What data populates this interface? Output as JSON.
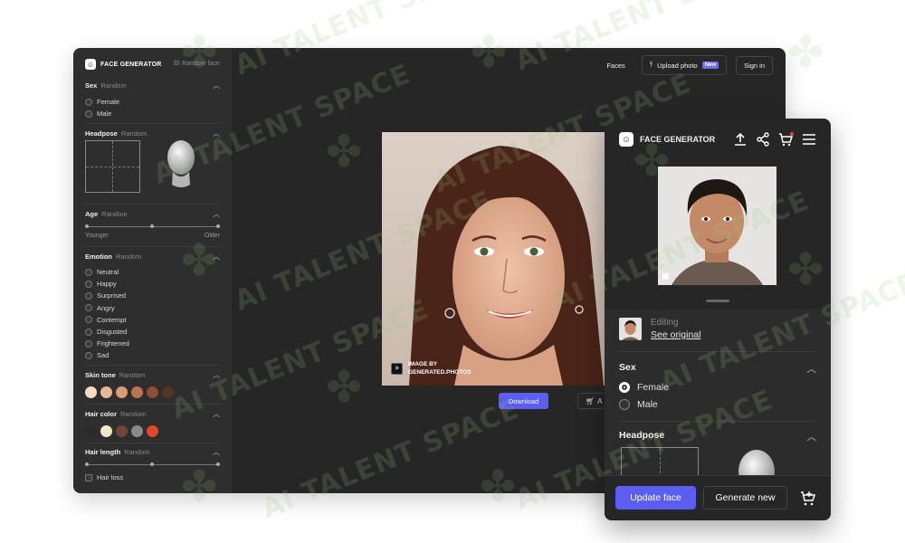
{
  "watermark": {
    "text": "AI TALENT SPACE"
  },
  "desktop": {
    "brand": "FACE GENERATOR",
    "random_face": "Random face",
    "topbar": {
      "faces": "Faces",
      "upload": "Upload photo",
      "new_badge": "New",
      "sign_in": "Sign in"
    },
    "sidebar": {
      "random": "Random",
      "sex": {
        "title": "Sex",
        "options": [
          "Female",
          "Male"
        ]
      },
      "headpose": {
        "title": "Headpose"
      },
      "age": {
        "title": "Age",
        "min": "Younger",
        "max": "Older"
      },
      "emotion": {
        "title": "Emotion",
        "options": [
          "Neutral",
          "Happy",
          "Surprised",
          "Angry",
          "Contempt",
          "Disgusted",
          "Frightened",
          "Sad"
        ]
      },
      "skin_tone": {
        "title": "Skin tone",
        "colors": [
          "#f3dcc0",
          "#e9b896",
          "#d99a74",
          "#bb7350",
          "#8c4f33",
          "#573226"
        ]
      },
      "hair_color": {
        "title": "Hair color",
        "colors": [
          "#2a2a2a",
          "#f2e6c4",
          "#6e4834",
          "#8a8a8a",
          "#e0482c"
        ]
      },
      "hair_length": {
        "title": "Hair length"
      },
      "hair_loss": "Hair loss"
    },
    "credit": {
      "line1": "IMAGE BY",
      "line2": "GENERATED.PHOTOS"
    },
    "download": "Download",
    "cart_partial": "A"
  },
  "mobile": {
    "brand": "FACE GENERATOR",
    "editing": "Editing",
    "see_original": "See original",
    "sex": {
      "title": "Sex",
      "options": [
        "Female",
        "Male"
      ],
      "selected": "Female"
    },
    "headpose": {
      "title": "Headpose"
    },
    "update": "Update face",
    "generate": "Generate new"
  }
}
